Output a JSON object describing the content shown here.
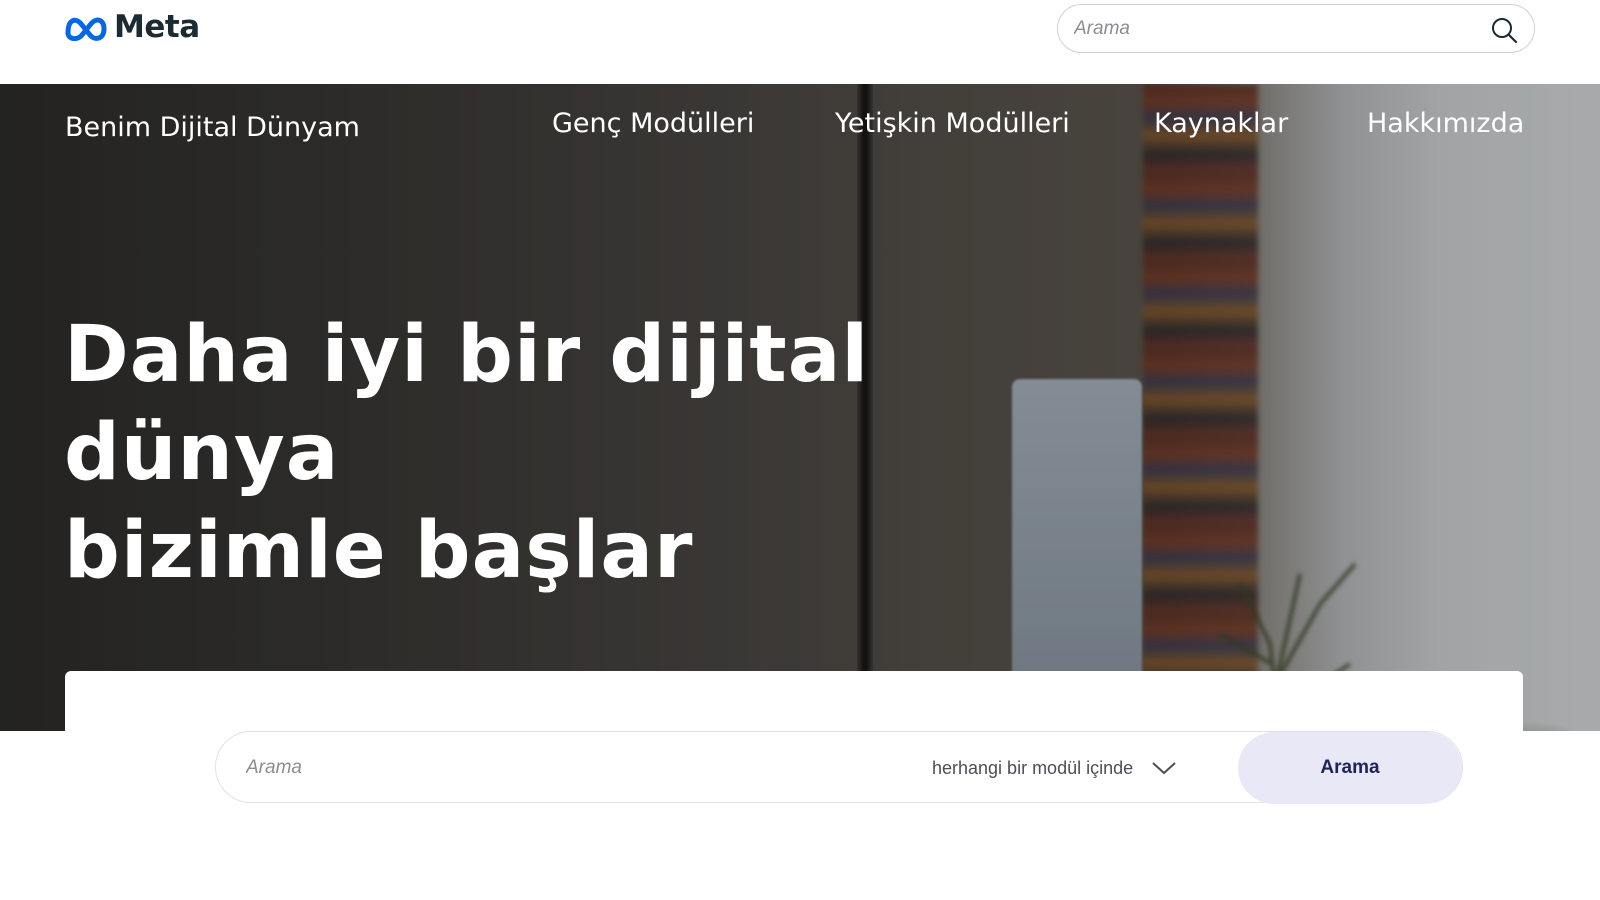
{
  "header": {
    "logo_text": "Meta",
    "search": {
      "placeholder": "Arama",
      "value": ""
    },
    "icons": {
      "logo": "meta-infinity-icon",
      "search": "search-icon"
    }
  },
  "hero": {
    "brand_link": "Benim Dijital Dünyam",
    "nav": [
      {
        "label": "Genç Modülleri"
      },
      {
        "label": "Yetişkin Modülleri"
      },
      {
        "label": "Kaynaklar"
      },
      {
        "label": "Hakkımızda"
      }
    ],
    "headline_line1": "Daha iyi bir dijital dünya",
    "headline_line2": "bizimle başlar"
  },
  "module_search": {
    "placeholder": "Arama",
    "value": "",
    "scope_selected": "herhangi bir modül içinde",
    "submit_label": "Arama",
    "icons": {
      "dropdown": "chevron-down-icon"
    }
  },
  "colors": {
    "logo_blue": "#0668e1",
    "text_dark": "#1c2b33",
    "submit_bg": "#e8e8f7",
    "submit_text": "#1d2457"
  }
}
